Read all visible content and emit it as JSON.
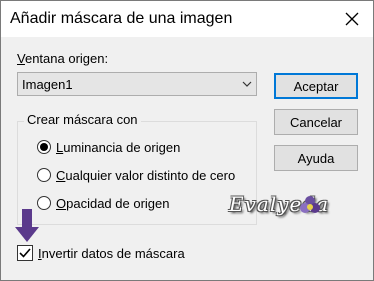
{
  "window": {
    "title": "Añadir máscara de una imagen"
  },
  "source": {
    "label_access": "V",
    "label_rest": "entana origen:",
    "selected": "Imagen1"
  },
  "buttons": {
    "accept": "Aceptar",
    "cancel": "Cancelar",
    "help": "Ayuda"
  },
  "mask_group": {
    "title": "Crear máscara con",
    "options": [
      {
        "access": "L",
        "rest": "uminancia de origen",
        "checked": true
      },
      {
        "access": "C",
        "rest": "ualquier valor distinto de cero",
        "checked": false
      },
      {
        "access": "O",
        "rest": "pacidad de origen",
        "checked": false
      }
    ]
  },
  "invert": {
    "access": "I",
    "rest": "nvertir datos de máscara",
    "checked": true
  },
  "watermark": {
    "text": "Evalyeda"
  },
  "colors": {
    "accent": "#0078d7",
    "arrow": "#5b3a8c",
    "signature_flower": "#6a4fa0"
  },
  "icons": {
    "close": "close-icon",
    "dropdown": "chevron-down-icon",
    "arrow": "arrow-down-icon"
  }
}
